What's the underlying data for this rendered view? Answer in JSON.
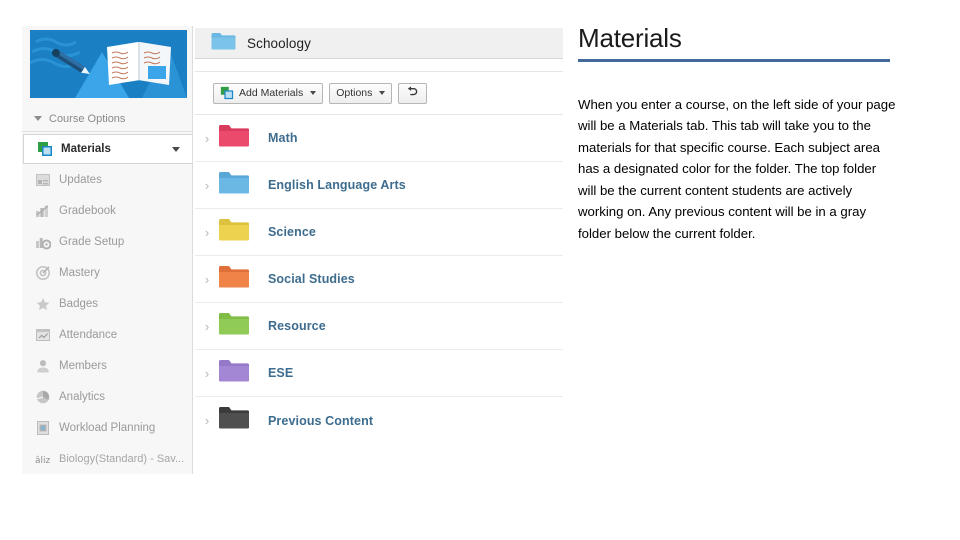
{
  "sidebar": {
    "banner": {
      "name": "course-banner-illustration"
    },
    "course_options_label": "Course Options",
    "items": [
      {
        "label": "Materials",
        "icon": "materials-icon",
        "selected": true,
        "caret": true
      },
      {
        "label": "Updates",
        "icon": "updates-icon",
        "selected": false,
        "caret": false
      },
      {
        "label": "Gradebook",
        "icon": "gradebook-icon",
        "selected": false,
        "caret": false
      },
      {
        "label": "Grade Setup",
        "icon": "grade-setup-icon",
        "selected": false,
        "caret": false
      },
      {
        "label": "Mastery",
        "icon": "mastery-icon",
        "selected": false,
        "caret": false
      },
      {
        "label": "Badges",
        "icon": "badges-icon",
        "selected": false,
        "caret": false
      },
      {
        "label": "Attendance",
        "icon": "attendance-icon",
        "selected": false,
        "caret": false
      },
      {
        "label": "Members",
        "icon": "members-icon",
        "selected": false,
        "caret": false
      },
      {
        "label": "Analytics",
        "icon": "analytics-icon",
        "selected": false,
        "caret": false
      },
      {
        "label": "Workload Planning",
        "icon": "workload-planning-icon",
        "selected": false,
        "caret": false
      },
      {
        "label": "Biology(Standard) - Sav...",
        "icon": "course-icon",
        "selected": false,
        "caret": false
      }
    ]
  },
  "materials": {
    "header_title": "Schoology",
    "header_icon": "folder-icon-blue",
    "toolbar": {
      "add_materials_label": "Add Materials",
      "add_materials_icon": "add-materials-icon",
      "options_label": "Options",
      "undo_icon": "undo-arrow-icon"
    },
    "folders": [
      {
        "name": "Math",
        "color": "#ec4a6d"
      },
      {
        "name": "English Language Arts",
        "color": "#6cb8e4"
      },
      {
        "name": "Science",
        "color": "#edd24f"
      },
      {
        "name": "Social Studies",
        "color": "#ef8348"
      },
      {
        "name": "Resource",
        "color": "#8fcb56"
      },
      {
        "name": "ESE",
        "color": "#a487d4"
      },
      {
        "name": "Previous Content",
        "color": "#4f4f4f"
      }
    ]
  },
  "right": {
    "heading": "Materials",
    "rule_color": "#44699c",
    "body": "When you enter a course, on the left side of your page will be a Materials tab.  This tab will take you to the materials for that specific course.  Each subject area has a designated color for the folder. The top folder will be the current content students are actively working on.  Any previous content will be in a gray folder below the current folder."
  }
}
